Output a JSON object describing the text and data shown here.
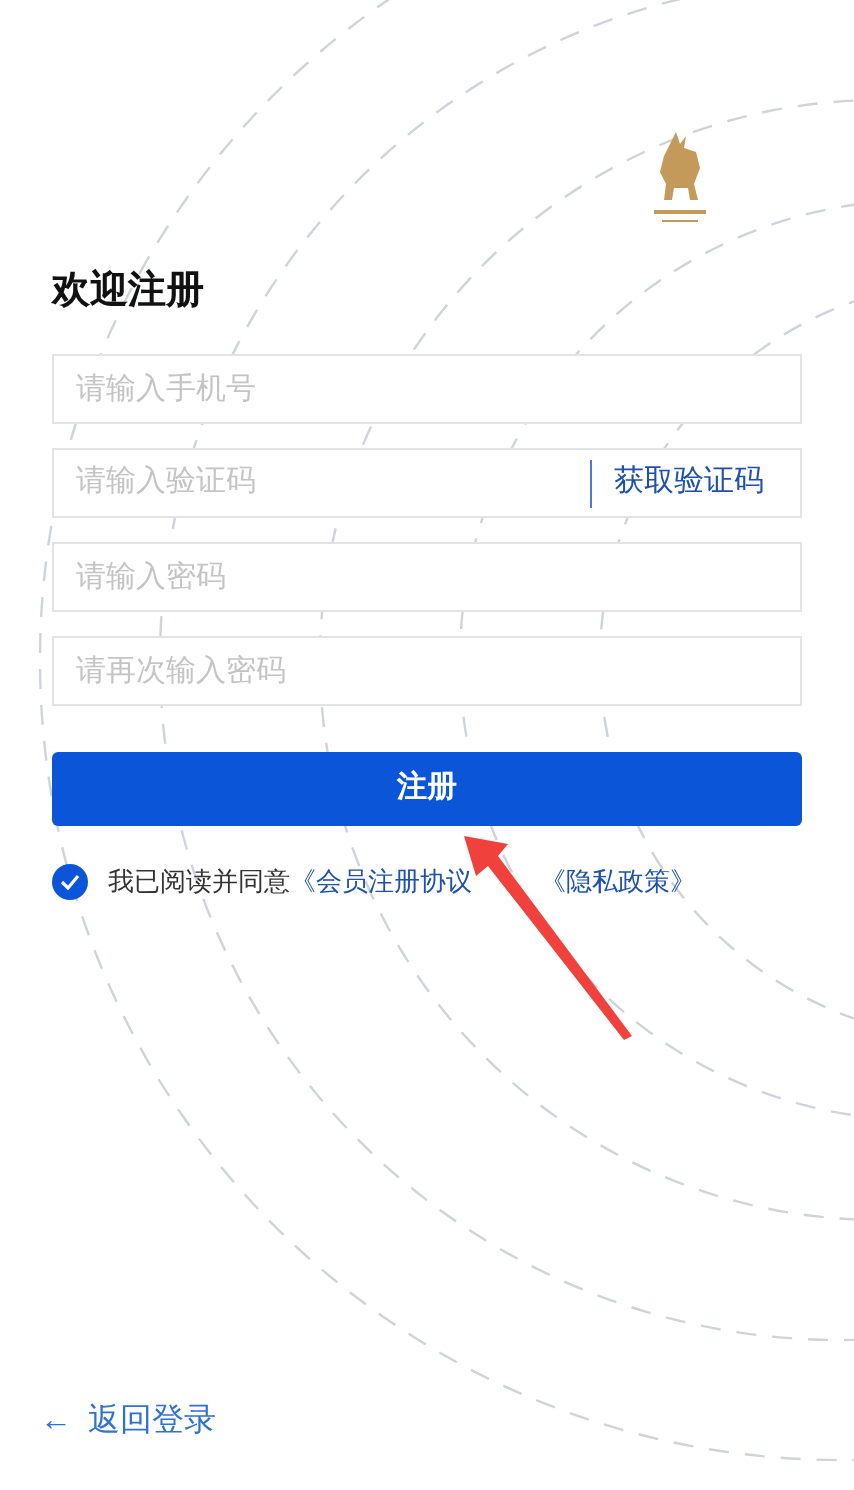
{
  "title": "欢迎注册",
  "fields": [
    {
      "placeholder": "请输入手机号"
    },
    {
      "placeholder": "请输入验证码",
      "action": "获取验证码"
    },
    {
      "placeholder": "请输入密码"
    },
    {
      "placeholder": "请再次输入密码"
    }
  ],
  "submit": "注册",
  "agreement": {
    "checked": true,
    "text": "我已阅读并同意",
    "links": [
      "《会员注册协议",
      "《隐私政策》"
    ]
  },
  "back_link": {
    "arrow": "←",
    "label": "返回登录"
  }
}
